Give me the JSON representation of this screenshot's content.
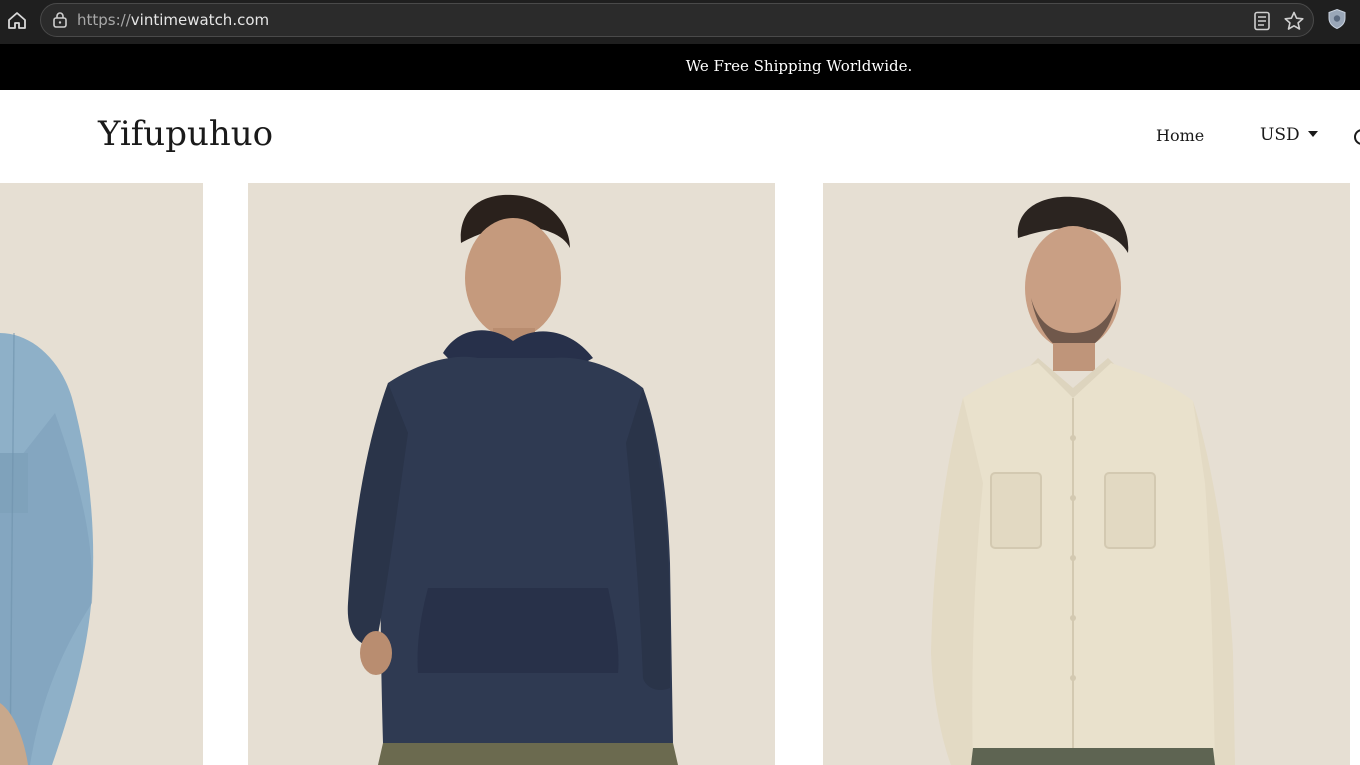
{
  "browser": {
    "url_protocol": "https://",
    "url_host": "vintimewatch.com"
  },
  "announcement": {
    "text": "We Free Shipping Worldwide."
  },
  "header": {
    "logo": "Yifupuhuo",
    "nav": {
      "home": "Home",
      "currency": "USD"
    }
  },
  "products": [
    {
      "name": "product-image-denim-shirt",
      "garment": "light blue denim shirt"
    },
    {
      "name": "product-image-navy-hoodie",
      "garment": "navy knit hoodie"
    },
    {
      "name": "product-image-cream-shirt",
      "garment": "cream linen button shirt"
    }
  ],
  "colors": {
    "chrome_bg": "#1f1f1f",
    "announcement_bg": "#000000",
    "announcement_text": "#ffffff",
    "photo_backdrop": "#e6dfd3",
    "navy_hoodie": "#2f3a52",
    "cream_shirt": "#e9e1cc",
    "denim_shirt": "#8eb0c8"
  }
}
